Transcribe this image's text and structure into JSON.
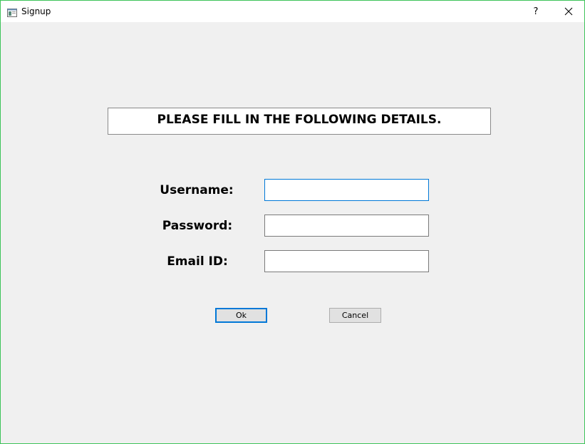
{
  "window": {
    "title": "Signup",
    "help_label": "?"
  },
  "form": {
    "heading": "PLEASE FILL IN THE FOLLOWING DETAILS.",
    "username_label": "Username:",
    "username_value": "",
    "password_label": "Password:",
    "password_value": "",
    "email_label": "Email ID:",
    "email_value": ""
  },
  "buttons": {
    "ok_label": "Ok",
    "cancel_label": "Cancel"
  },
  "colors": {
    "window_border": "#3ec45a",
    "focus_accent": "#0078d7",
    "background": "#f0f0f0"
  }
}
